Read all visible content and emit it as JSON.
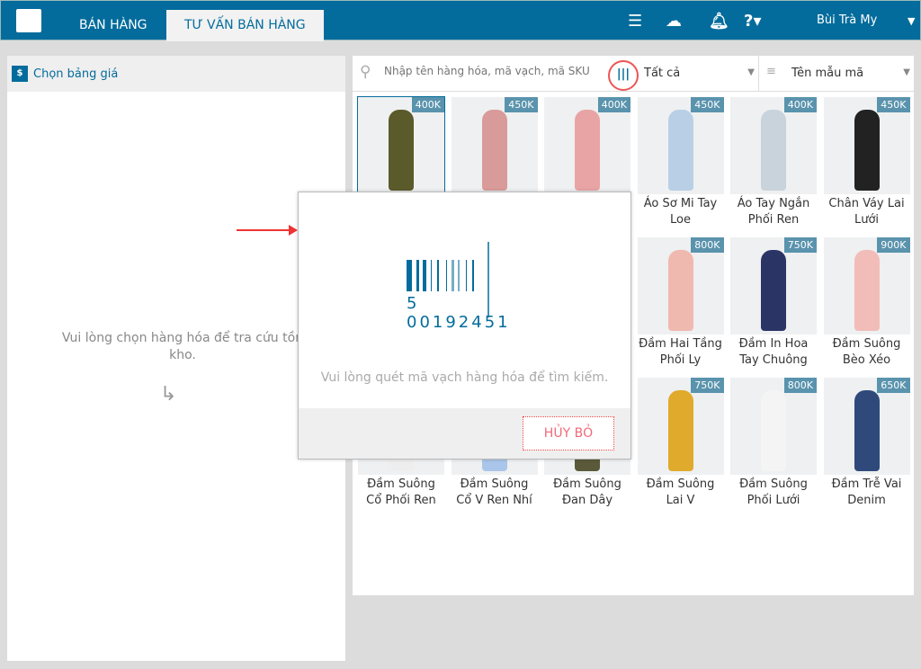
{
  "header": {
    "tabs": [
      {
        "label": "BÁN HÀNG"
      },
      {
        "label": "TƯ VẤN BÁN HÀNG"
      }
    ],
    "user": "Bùi Trà My"
  },
  "left": {
    "price_list": "Chọn bảng giá",
    "message": "Vui lòng chọn hàng hóa để tra cứu tồn kho."
  },
  "toolbar": {
    "search_placeholder": "Nhập tên hàng hóa, mã vạch, mã SKU",
    "category": "Tất cả",
    "sort": "Tên mẫu mã"
  },
  "products": [
    {
      "price": "400K",
      "name": "",
      "color": "#5b5a2a"
    },
    {
      "price": "450K",
      "name": "",
      "color": "#d99a9a"
    },
    {
      "price": "400K",
      "name": "",
      "color": "#e8a4a4"
    },
    {
      "price": "450K",
      "name": "Áo Sơ Mi Tay Loe",
      "color": "#b8cfe6"
    },
    {
      "price": "400K",
      "name": "Áo Tay Ngắn Phối Ren",
      "color": "#c9d3dc"
    },
    {
      "price": "450K",
      "name": "Chân Váy Lai Lưới",
      "color": "#222"
    },
    {
      "price": "",
      "name": "",
      "color": "#ccc"
    },
    {
      "price": "",
      "name": "",
      "color": "#ccc"
    },
    {
      "price": "",
      "name": "",
      "color": "#ccc"
    },
    {
      "price": "800K",
      "name": "Đầm Hai Tầng Phối Ly",
      "color": "#f0b9b0"
    },
    {
      "price": "750K",
      "name": "Đầm In Hoa Tay Chuông",
      "color": "#2a3566"
    },
    {
      "price": "900K",
      "name": "Đầm Suông Bèo Xéo",
      "color": "#f2bdb8"
    },
    {
      "price": "",
      "name": "Đầm Suông Cổ Phối Ren",
      "color": "#eee"
    },
    {
      "price": "",
      "name": "Đầm Suông Cổ V Ren Nhí",
      "color": "#a9c6ea"
    },
    {
      "price": "",
      "name": "Đầm Suông Đan Dây",
      "color": "#5a5a3a"
    },
    {
      "price": "750K",
      "name": "Đầm Suông Lai V",
      "color": "#e0aa2c"
    },
    {
      "price": "800K",
      "name": "Đầm Suông Phối Lưới",
      "color": "#f4f4f4"
    },
    {
      "price": "650K",
      "name": "Đầm Trễ Vai Denim",
      "color": "#2f4a7a"
    }
  ],
  "modal": {
    "barcode_number": "5 00192451",
    "message": "Vui lòng quét mã vạch hàng hóa để tìm kiếm.",
    "cancel": "HỦY BỎ"
  }
}
